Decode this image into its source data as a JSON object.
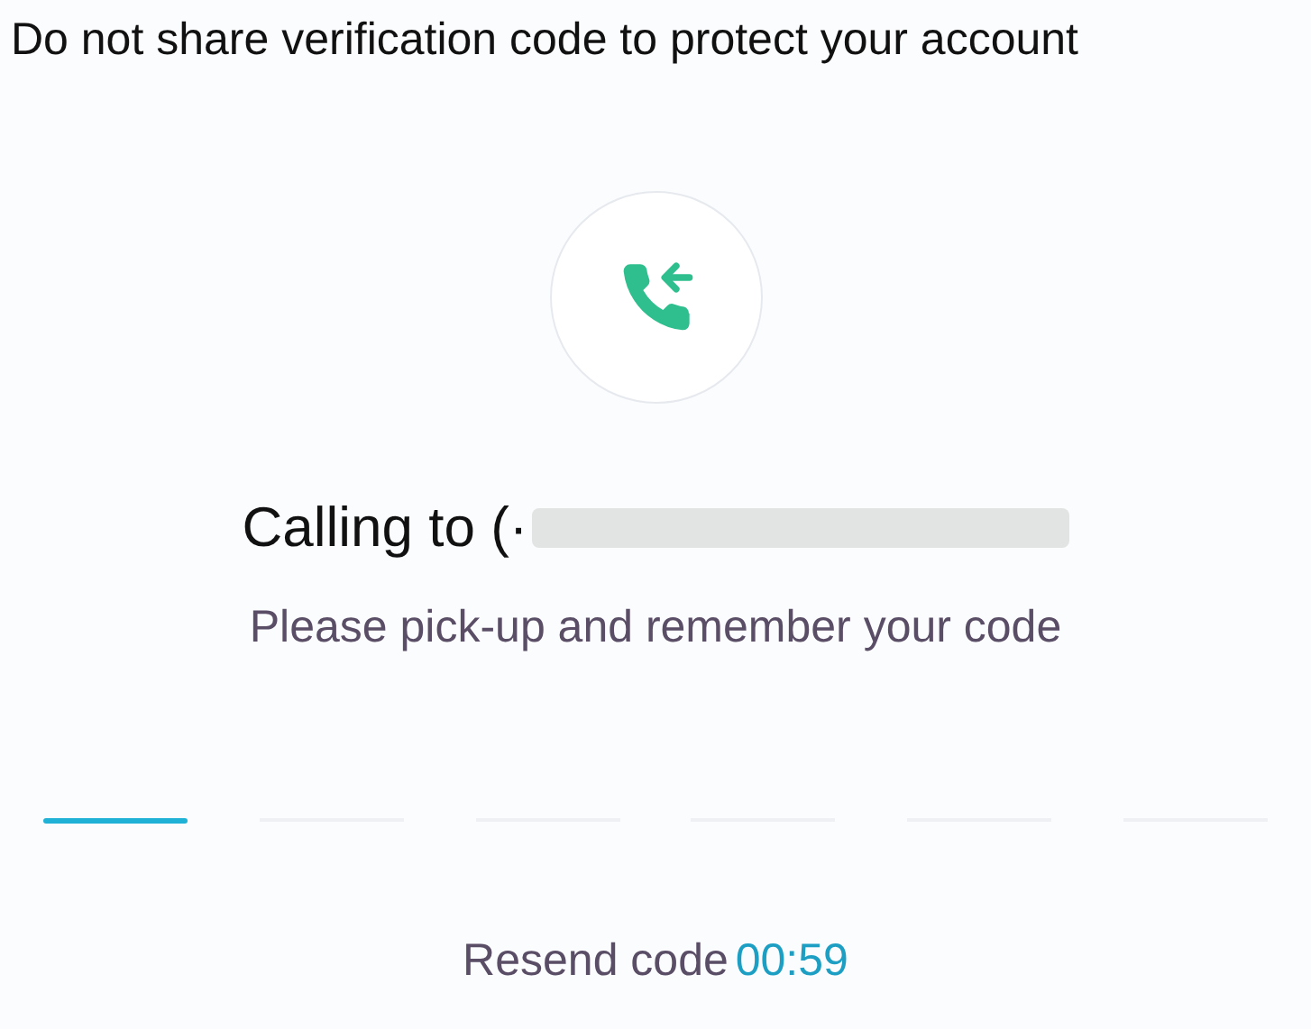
{
  "notice": "Do not share verification code to protect your account",
  "calling": {
    "text": "Calling to (·",
    "number_hidden": true
  },
  "instruction": "Please pick-up and remember your code",
  "code_slots": [
    {
      "selected": true
    },
    {
      "selected": false
    },
    {
      "selected": false
    },
    {
      "selected": false
    },
    {
      "selected": false
    },
    {
      "selected": false
    }
  ],
  "resend": {
    "label": "Resend code",
    "timer": "00:59"
  }
}
